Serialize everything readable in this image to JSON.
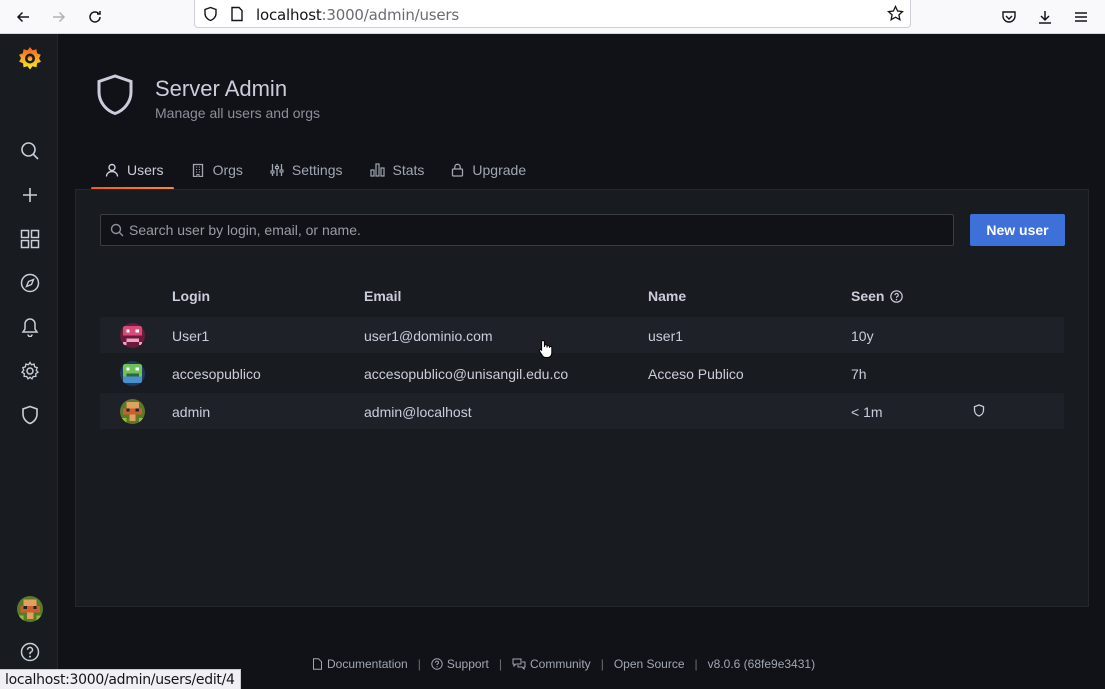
{
  "browser": {
    "url_host": "localhost",
    "url_path": ":3000/admin/users",
    "status_link": "localhost:3000/admin/users/edit/4",
    "icons": [
      "back-icon",
      "forward-icon",
      "reload-icon",
      "shield-icon",
      "page-icon",
      "star-icon",
      "pocket-icon",
      "download-icon",
      "menu-icon"
    ]
  },
  "sidemenu": {
    "items": [
      "search-icon",
      "plus-icon",
      "dashboards-icon",
      "explore-icon",
      "alerting-icon",
      "configuration-icon",
      "server-admin-icon"
    ],
    "bottom": [
      "user-avatar",
      "help-icon"
    ]
  },
  "header": {
    "title": "Server Admin",
    "subtitle": "Manage all users and orgs"
  },
  "tabs": [
    {
      "label": "Users",
      "icon": "user-icon",
      "active": true
    },
    {
      "label": "Orgs",
      "icon": "building-icon",
      "active": false
    },
    {
      "label": "Settings",
      "icon": "sliders-icon",
      "active": false
    },
    {
      "label": "Stats",
      "icon": "bar-chart-icon",
      "active": false
    },
    {
      "label": "Upgrade",
      "icon": "lock-icon",
      "active": false
    }
  ],
  "search": {
    "placeholder": "Search user by login, email, or name."
  },
  "new_user_label": "New user",
  "table": {
    "columns": {
      "login": "Login",
      "email": "Email",
      "name": "Name",
      "seen": "Seen"
    },
    "rows": [
      {
        "login": "User1",
        "email": "user1@dominio.com",
        "name": "user1",
        "seen": "10y",
        "is_admin": false
      },
      {
        "login": "accesopublico",
        "email": "accesopublico@unisangil.edu.co",
        "name": "Acceso Publico",
        "seen": "7h",
        "is_admin": false
      },
      {
        "login": "admin",
        "email": "admin@localhost",
        "name": "",
        "seen": "< 1m",
        "is_admin": true
      }
    ]
  },
  "footer": {
    "documentation": "Documentation",
    "support": "Support",
    "community": "Community",
    "open_source": "Open Source",
    "version": "v8.0.6 (68fe9e3431)"
  },
  "colors": {
    "accent": "#3d71d9",
    "tab_underline": "#f05a28",
    "background": "#111217",
    "panel": "#181b1f"
  }
}
